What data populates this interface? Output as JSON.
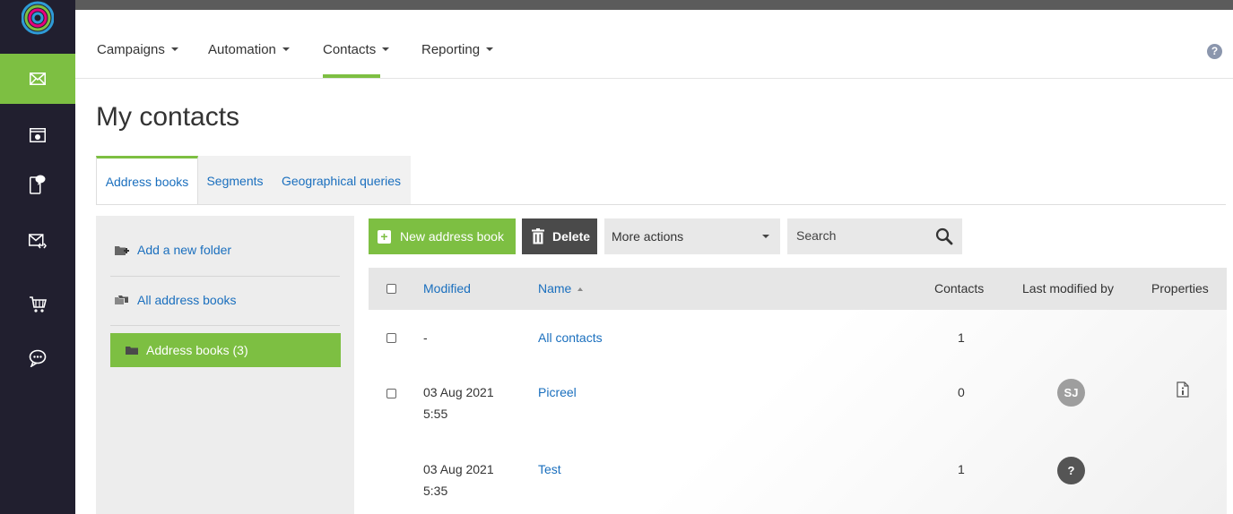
{
  "sidebar": {
    "items": [
      {
        "icon": "mail-icon",
        "active": true
      },
      {
        "icon": "landing-page-icon",
        "active": false
      },
      {
        "icon": "mobile-sms-icon",
        "active": false
      },
      {
        "icon": "transactional-mail-icon",
        "active": false
      },
      {
        "icon": "ecommerce-cart-icon",
        "active": false
      },
      {
        "icon": "chat-icon",
        "active": false
      }
    ]
  },
  "nav": {
    "items": [
      {
        "label": "Campaigns"
      },
      {
        "label": "Automation"
      },
      {
        "label": "Contacts"
      },
      {
        "label": "Reporting"
      }
    ],
    "active": "Contacts",
    "help_glyph": "?"
  },
  "page": {
    "title": "My contacts"
  },
  "tabs": [
    {
      "label": "Address books"
    },
    {
      "label": "Segments"
    },
    {
      "label": "Geographical queries"
    }
  ],
  "folders": {
    "add_label": "Add a new folder",
    "all_label": "All address books",
    "active_label": "Address books (3)"
  },
  "toolbar": {
    "new_label": "New address book",
    "delete_label": "Delete",
    "more_actions_label": "More actions",
    "search_placeholder": "Search"
  },
  "table": {
    "headers": {
      "modified": "Modified",
      "name": "Name",
      "contacts": "Contacts",
      "last_modified_by": "Last modified by",
      "properties": "Properties"
    },
    "rows": [
      {
        "modified_date": "-",
        "modified_time": "",
        "name": "All contacts",
        "contacts": "1",
        "avatar": ""
      },
      {
        "modified_date": "03 Aug 2021",
        "modified_time": "5:55",
        "name": "Picreel",
        "contacts": "0",
        "avatar": "SJ"
      },
      {
        "modified_date": "03 Aug 2021",
        "modified_time": "5:35",
        "name": "Test",
        "contacts": "1",
        "avatar": "?"
      }
    ]
  },
  "colors": {
    "accent": "#7dbf42",
    "sidebar_bg": "#211f2f",
    "link": "#1a6fbe",
    "avatar_sj": "#9e9e9e",
    "avatar_unknown": "#555555"
  }
}
